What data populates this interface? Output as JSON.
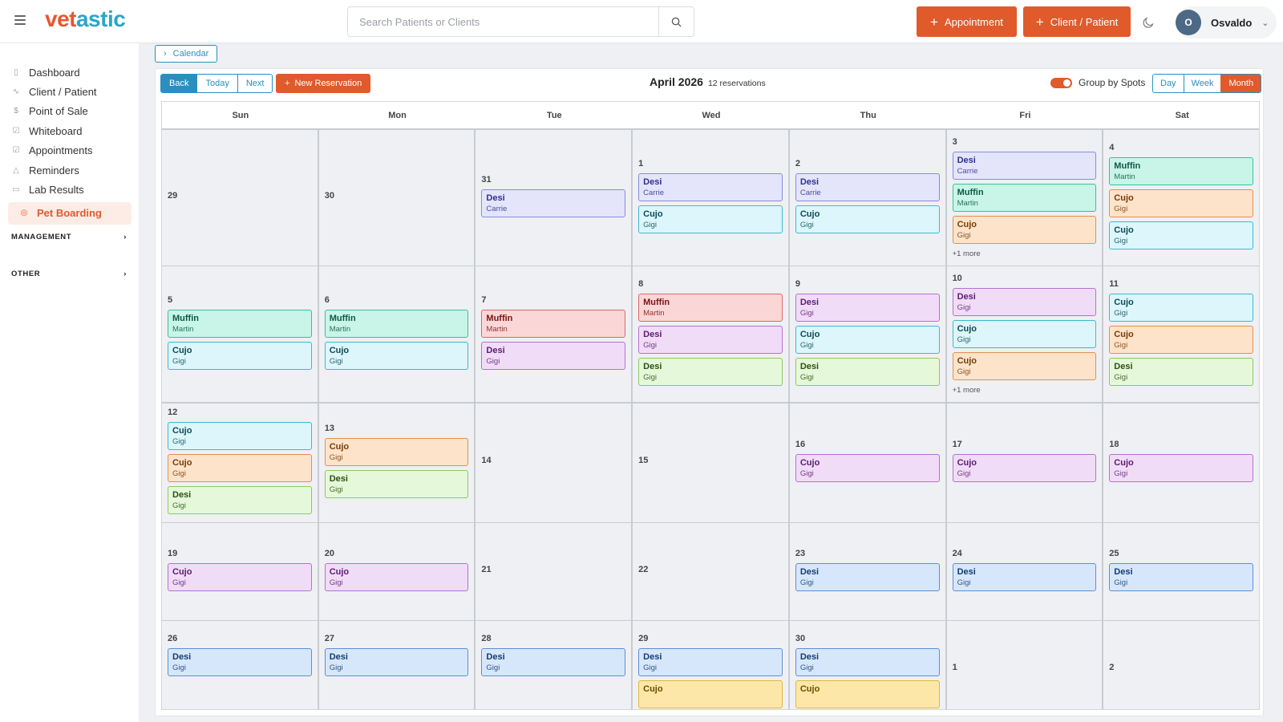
{
  "brand": {
    "part1": "vet",
    "part2": "astic"
  },
  "search": {
    "placeholder": "Search Patients or Clients"
  },
  "header": {
    "appointment_label": "Appointment",
    "client_label": "Client / Patient",
    "user_initial": "O",
    "user_name": "Osvaldo"
  },
  "sidebar": {
    "items": [
      {
        "label": "Dashboard",
        "icon": "clipboard-icon",
        "glyph": "▯"
      },
      {
        "label": "Client / Patient",
        "icon": "pulse-icon",
        "glyph": "∿"
      },
      {
        "label": "Point of Sale",
        "icon": "dollar-icon",
        "glyph": "$"
      },
      {
        "label": "Whiteboard",
        "icon": "checkbox-icon",
        "glyph": "☑"
      },
      {
        "label": "Appointments",
        "icon": "calendar-check-icon",
        "glyph": "☑"
      },
      {
        "label": "Reminders",
        "icon": "alert-icon",
        "glyph": "△"
      },
      {
        "label": "Lab Results",
        "icon": "archive-icon",
        "glyph": "▭"
      },
      {
        "label": "Pet Boarding",
        "icon": "boarding-icon",
        "glyph": "◎",
        "active": true
      }
    ],
    "sections": [
      {
        "label": "MANAGEMENT"
      },
      {
        "label": "OTHER"
      }
    ]
  },
  "breadcrumb": {
    "label": "Calendar"
  },
  "toolbar": {
    "back": "Back",
    "today": "Today",
    "next": "Next",
    "new_reservation": "New Reservation",
    "title": "April 2026",
    "count": "12 reservations",
    "group_by": "Group by Spots",
    "views": [
      "Day",
      "Week",
      "Month"
    ],
    "active_view": "Month"
  },
  "calendar": {
    "weekdays": [
      "Sun",
      "Mon",
      "Tue",
      "Wed",
      "Thu",
      "Fri",
      "Sat"
    ],
    "weeks": [
      [
        {
          "day": "29",
          "events": []
        },
        {
          "day": "30",
          "events": []
        },
        {
          "day": "31",
          "events": [
            {
              "pet": "Desi",
              "client": "Carrie",
              "color": "purple"
            }
          ]
        },
        {
          "day": "1",
          "events": [
            {
              "pet": "Desi",
              "client": "Carrie",
              "color": "purple"
            },
            {
              "pet": "Cujo",
              "client": "Gigi",
              "color": "cyan"
            }
          ]
        },
        {
          "day": "2",
          "events": [
            {
              "pet": "Desi",
              "client": "Carrie",
              "color": "purple"
            },
            {
              "pet": "Cujo",
              "client": "Gigi",
              "color": "cyan"
            }
          ]
        },
        {
          "day": "3",
          "events": [
            {
              "pet": "Desi",
              "client": "Carrie",
              "color": "purple"
            },
            {
              "pet": "Muffin",
              "client": "Martin",
              "color": "teal"
            },
            {
              "pet": "Cujo",
              "client": "Gigi",
              "color": "orange"
            }
          ],
          "more": "+1 more"
        },
        {
          "day": "4",
          "events": [
            {
              "pet": "Muffin",
              "client": "Martin",
              "color": "teal"
            },
            {
              "pet": "Cujo",
              "client": "Gigi",
              "color": "orange"
            },
            {
              "pet": "Cujo",
              "client": "Gigi",
              "color": "cyan"
            }
          ]
        }
      ],
      [
        {
          "day": "5",
          "events": [
            {
              "pet": "Muffin",
              "client": "Martin",
              "color": "teal"
            },
            {
              "pet": "Cujo",
              "client": "Gigi",
              "color": "cyan"
            }
          ]
        },
        {
          "day": "6",
          "events": [
            {
              "pet": "Muffin",
              "client": "Martin",
              "color": "teal"
            },
            {
              "pet": "Cujo",
              "client": "Gigi",
              "color": "cyan"
            }
          ]
        },
        {
          "day": "7",
          "events": [
            {
              "pet": "Muffin",
              "client": "Martin",
              "color": "red"
            },
            {
              "pet": "Desi",
              "client": "Gigi",
              "color": "violet"
            }
          ]
        },
        {
          "day": "8",
          "events": [
            {
              "pet": "Muffin",
              "client": "Martin",
              "color": "red"
            },
            {
              "pet": "Desi",
              "client": "Gigi",
              "color": "violet"
            },
            {
              "pet": "Desi",
              "client": "Gigi",
              "color": "green"
            }
          ]
        },
        {
          "day": "9",
          "events": [
            {
              "pet": "Desi",
              "client": "Gigi",
              "color": "violet"
            },
            {
              "pet": "Cujo",
              "client": "Gigi",
              "color": "cyan"
            },
            {
              "pet": "Desi",
              "client": "Gigi",
              "color": "green"
            }
          ]
        },
        {
          "day": "10",
          "events": [
            {
              "pet": "Desi",
              "client": "Gigi",
              "color": "violet"
            },
            {
              "pet": "Cujo",
              "client": "Gigi",
              "color": "cyan"
            },
            {
              "pet": "Cujo",
              "client": "Gigi",
              "color": "orange"
            }
          ],
          "more": "+1 more"
        },
        {
          "day": "11",
          "events": [
            {
              "pet": "Cujo",
              "client": "Gigi",
              "color": "cyan"
            },
            {
              "pet": "Cujo",
              "client": "Gigi",
              "color": "orange"
            },
            {
              "pet": "Desi",
              "client": "Gigi",
              "color": "green"
            }
          ]
        }
      ],
      [
        {
          "day": "12",
          "events": [
            {
              "pet": "Cujo",
              "client": "Gigi",
              "color": "cyan"
            },
            {
              "pet": "Cujo",
              "client": "Gigi",
              "color": "orange"
            },
            {
              "pet": "Desi",
              "client": "Gigi",
              "color": "green"
            }
          ]
        },
        {
          "day": "13",
          "events": [
            {
              "pet": "Cujo",
              "client": "Gigi",
              "color": "orange"
            },
            {
              "pet": "Desi",
              "client": "Gigi",
              "color": "green"
            }
          ]
        },
        {
          "day": "14",
          "events": []
        },
        {
          "day": "15",
          "events": []
        },
        {
          "day": "16",
          "events": [
            {
              "pet": "Cujo",
              "client": "Gigi",
              "color": "violet"
            }
          ]
        },
        {
          "day": "17",
          "events": [
            {
              "pet": "Cujo",
              "client": "Gigi",
              "color": "violet"
            }
          ]
        },
        {
          "day": "18",
          "events": [
            {
              "pet": "Cujo",
              "client": "Gigi",
              "color": "violet"
            }
          ]
        }
      ],
      [
        {
          "day": "19",
          "events": [
            {
              "pet": "Cujo",
              "client": "Gigi",
              "color": "violet"
            }
          ]
        },
        {
          "day": "20",
          "events": [
            {
              "pet": "Cujo",
              "client": "Gigi",
              "color": "violet"
            }
          ]
        },
        {
          "day": "21",
          "events": []
        },
        {
          "day": "22",
          "events": []
        },
        {
          "day": "23",
          "events": [
            {
              "pet": "Desi",
              "client": "Gigi",
              "color": "blue"
            }
          ]
        },
        {
          "day": "24",
          "events": [
            {
              "pet": "Desi",
              "client": "Gigi",
              "color": "blue"
            }
          ]
        },
        {
          "day": "25",
          "events": [
            {
              "pet": "Desi",
              "client": "Gigi",
              "color": "blue"
            }
          ]
        }
      ],
      [
        {
          "day": "26",
          "events": [
            {
              "pet": "Desi",
              "client": "Gigi",
              "color": "blue"
            }
          ]
        },
        {
          "day": "27",
          "events": [
            {
              "pet": "Desi",
              "client": "Gigi",
              "color": "blue"
            }
          ]
        },
        {
          "day": "28",
          "events": [
            {
              "pet": "Desi",
              "client": "Gigi",
              "color": "blue"
            }
          ]
        },
        {
          "day": "29",
          "events": [
            {
              "pet": "Desi",
              "client": "Gigi",
              "color": "blue"
            },
            {
              "pet": "Cujo",
              "client": "",
              "color": "yellow"
            }
          ]
        },
        {
          "day": "30",
          "events": [
            {
              "pet": "Desi",
              "client": "Gigi",
              "color": "blue"
            },
            {
              "pet": "Cujo",
              "client": "",
              "color": "yellow"
            }
          ]
        },
        {
          "day": "1",
          "events": []
        },
        {
          "day": "2",
          "events": []
        }
      ]
    ]
  },
  "colors": {
    "accent": "#e05a2b",
    "primary": "#2a8fbf"
  }
}
